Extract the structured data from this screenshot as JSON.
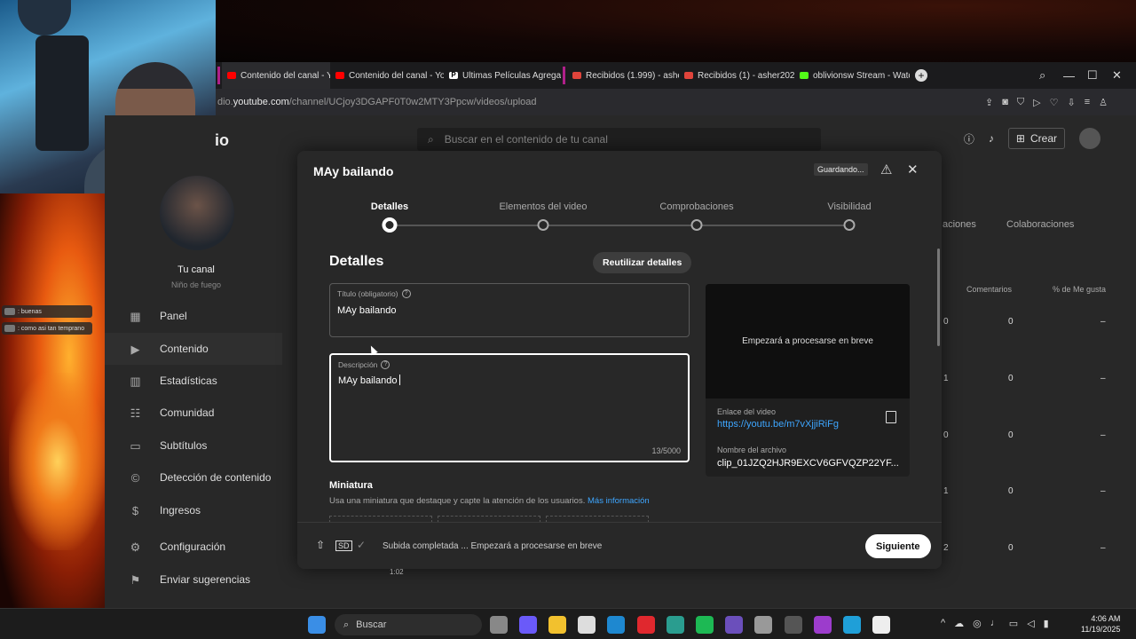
{
  "browser": {
    "tabs": [
      {
        "label": "Contenido del canal - You",
        "icon": "youtube-icon",
        "active": true
      },
      {
        "label": "Contenido del canal - You",
        "icon": "youtube-icon"
      },
      {
        "label": "Ultimas Películas Agregad",
        "icon": "p-icon"
      },
      {
        "label": "Recibidos (1.999) - asher.",
        "icon": "gmail-icon"
      },
      {
        "label": "Recibidos (1) - asher2020",
        "icon": "gmail-icon"
      },
      {
        "label": "oblivionsw Stream - Watc",
        "icon": "kick-icon"
      }
    ],
    "url_prefix": "dio.",
    "url_domain": "youtube.com",
    "url_path": "/channel/UCjoy3DGAPF0T0w2MTY3Ppcw/videos/upload"
  },
  "stream_chat": [
    {
      "text": ": buenas"
    },
    {
      "text": ": como asi tan temprano"
    }
  ],
  "studio": {
    "logo": "io",
    "search_placeholder": "Buscar en el contenido de tu canal",
    "create_label": "Crear",
    "channel_name": "Tu canal",
    "channel_handle": "Niño de fuego",
    "nav": [
      {
        "label": "Panel",
        "icon": "dashboard-icon"
      },
      {
        "label": "Contenido",
        "icon": "content-icon",
        "active": true
      },
      {
        "label": "Estadísticas",
        "icon": "analytics-icon"
      },
      {
        "label": "Comunidad",
        "icon": "community-icon"
      },
      {
        "label": "Subtítulos",
        "icon": "subtitles-icon"
      },
      {
        "label": "Detección de contenido",
        "icon": "copyright-icon"
      },
      {
        "label": "Ingresos",
        "icon": "dollar-icon"
      },
      {
        "label": "Configuración",
        "icon": "gear-icon"
      },
      {
        "label": "Enviar sugerencias",
        "icon": "feedback-icon"
      }
    ],
    "background_tabs": [
      "aciones",
      "Colaboraciones"
    ],
    "background_columns": [
      "Comentarios",
      "% de Me gusta"
    ],
    "background_rows": [
      {
        "views": "0",
        "comments": "0",
        "likes": "–"
      },
      {
        "views": "1",
        "comments": "0",
        "likes": "–"
      },
      {
        "views": "0",
        "comments": "0",
        "likes": "–"
      },
      {
        "views": "1",
        "comments": "0",
        "likes": "–"
      },
      {
        "views": "2",
        "comments": "0",
        "likes": "–"
      }
    ],
    "background_duration": "1:02"
  },
  "dialog": {
    "title": "MAy bailando",
    "saving_badge": "Guardando...",
    "steps": [
      {
        "label": "Detalles",
        "active": true
      },
      {
        "label": "Elementos del video"
      },
      {
        "label": "Comprobaciones"
      },
      {
        "label": "Visibilidad"
      }
    ],
    "section_title": "Detalles",
    "reuse_button": "Reutilizar detalles",
    "title_field": {
      "label": "Título (obligatorio)",
      "value": "MAy bailando"
    },
    "description_field": {
      "label": "Descripción",
      "value": "MAy bailando",
      "counter": "13/5000"
    },
    "preview": {
      "status": "Empezará a procesarse en breve",
      "link_label": "Enlace del video",
      "link": "https://youtu.be/m7vXjjiRiFg",
      "file_label": "Nombre del archivo",
      "file_name": "clip_01JZQ2HJR9EXCV6GFVQZP22YF..."
    },
    "thumbnail": {
      "title": "Miniatura",
      "description": "Usa una miniatura que destaque y capte la atención de los usuarios.",
      "more_link": "Más información"
    },
    "footer": {
      "hd_badge": "SD",
      "status": "Subida completada ... Empezará a procesarse en breve",
      "next_button": "Siguiente"
    }
  },
  "taskbar": {
    "search_placeholder": "Buscar",
    "time": "4:06 AM",
    "date": "11/19/2025"
  }
}
